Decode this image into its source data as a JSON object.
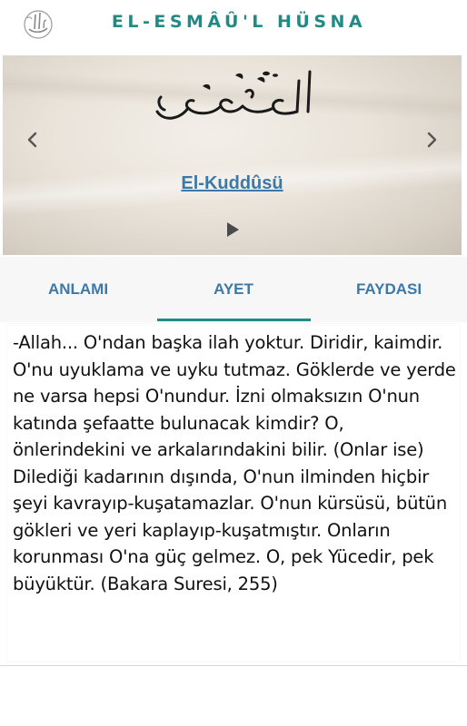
{
  "header": {
    "title": "EL-ESMÂÛ'L HÜSNA"
  },
  "banner": {
    "name": "El-Kuddûsü"
  },
  "tabs": [
    {
      "label": "ANLAMI"
    },
    {
      "label": "AYET"
    },
    {
      "label": "FAYDASI"
    }
  ],
  "active_tab": "AYET",
  "content": {
    "text": "-Allah... O'ndan başka ilah yoktur. Diridir, kaimdir. O'nu uyuklama ve uyku tutmaz. Göklerde ve yerde ne varsa hepsi O'nundur. İzni olmaksızın O'nun katında şefaatte bulunacak kimdir? O, önlerindekini ve arkalarındakini bilir. (Onlar ise) Dilediği kadarının dışında, O'nun ilminden hiçbir şeyi kavrayıp-kuşatamazlar. O'nun kürsüsü, bütün gökleri ve yeri kaplayıp-kuşatmıştır. Onların korunması O'na güç gelmez. O, pek Yücedir, pek büyüktür. (Bakara Suresi, 255)"
  },
  "colors": {
    "accent": "#1f8a86",
    "tab_text": "#3d79a8",
    "link": "#3d79a8"
  },
  "icons": {
    "logo": "allah-calligraphy-icon",
    "prev": "chevron-left-icon",
    "next": "chevron-right-icon",
    "play": "play-icon"
  }
}
